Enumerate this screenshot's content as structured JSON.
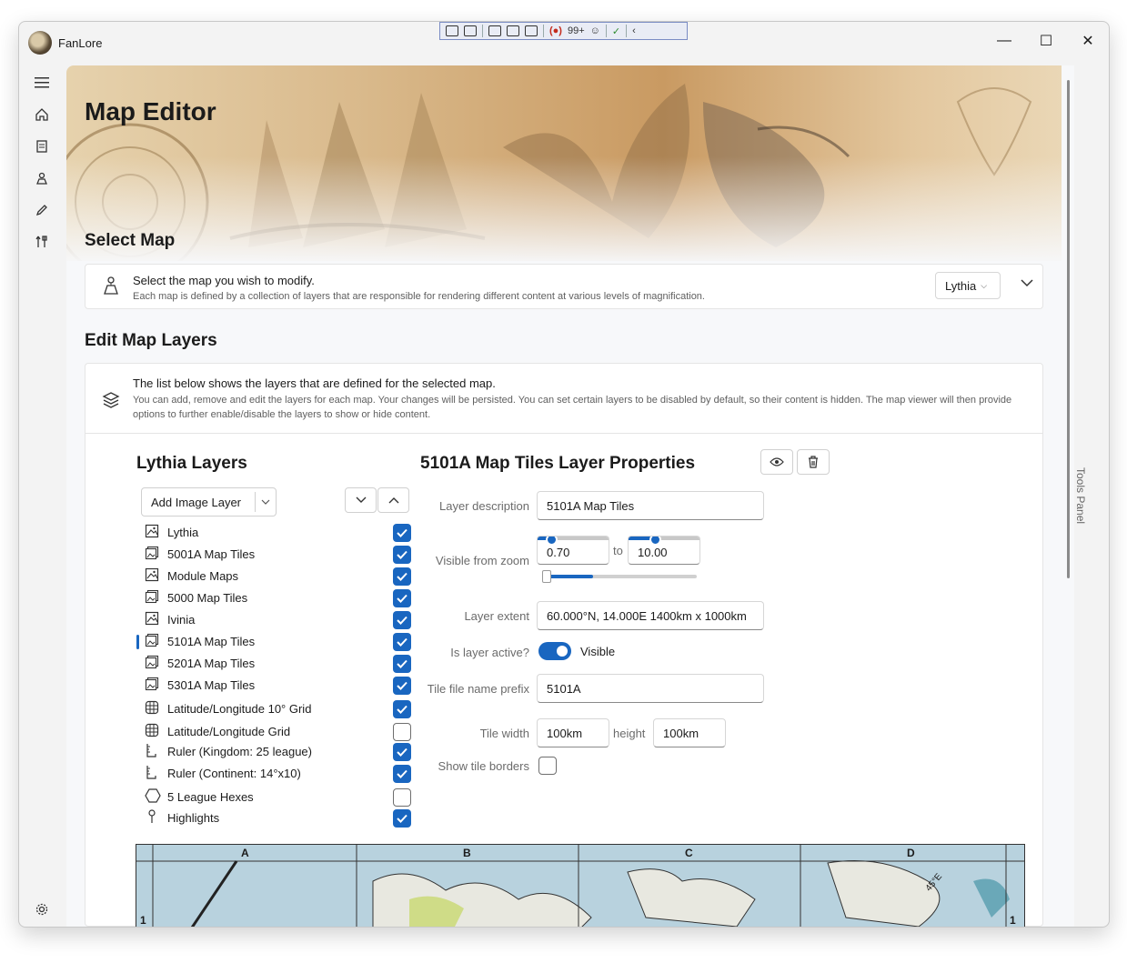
{
  "app": {
    "title": "FanLore"
  },
  "debug_toolbar": {
    "badge": "99+"
  },
  "window_controls": {
    "minimize": "—",
    "maximize": "☐",
    "close": "✕"
  },
  "nav": {
    "items": [
      "menu",
      "home",
      "notes",
      "map",
      "edit",
      "tools"
    ],
    "settings": "settings"
  },
  "page": {
    "title": "Map Editor"
  },
  "select_map": {
    "section_title": "Select Map",
    "heading": "Select the map you wish to modify.",
    "description": "Each map is defined by a collection of layers that are responsible for rendering different content at various levels of magnification.",
    "selected": "Lythia"
  },
  "edit_layers": {
    "section_title": "Edit Map Layers",
    "heading": "The list below shows the layers that are defined for the selected map.",
    "description": "You can add, remove and edit the layers for each map. Your changes will be persisted. You can set certain layers to be disabled by default, so their content is hidden. The map viewer will then provide options to further enable/disable the layers to show or hide content."
  },
  "layers_panel": {
    "title": "Lythia Layers",
    "add_button": "Add Image Layer",
    "items": [
      {
        "name": "Lythia",
        "icon": "image-icon",
        "checked": true
      },
      {
        "name": "5001A Map Tiles",
        "icon": "image-stack-icon",
        "checked": true
      },
      {
        "name": "Module Maps",
        "icon": "image-icon",
        "checked": true
      },
      {
        "name": "5000 Map Tiles",
        "icon": "image-stack-icon",
        "checked": true
      },
      {
        "name": "Ivinia",
        "icon": "image-icon",
        "checked": true
      },
      {
        "name": "5101A Map Tiles",
        "icon": "image-stack-icon",
        "checked": true,
        "selected": true
      },
      {
        "name": "5201A Map Tiles",
        "icon": "image-stack-icon",
        "checked": true
      },
      {
        "name": "5301A Map Tiles",
        "icon": "image-stack-icon",
        "checked": true
      },
      {
        "name": "Latitude/Longitude 10° Grid",
        "icon": "globe-grid-icon",
        "checked": true
      },
      {
        "name": "Latitude/Longitude Grid",
        "icon": "globe-grid-icon",
        "checked": false
      },
      {
        "name": "Ruler (Kingdom: 25 league)",
        "icon": "ruler-icon",
        "checked": true
      },
      {
        "name": "Ruler (Continent: 14°x10)",
        "icon": "ruler-icon",
        "checked": true
      },
      {
        "name": "5 League Hexes",
        "icon": "hexagon-icon",
        "checked": false
      },
      {
        "name": "Highlights",
        "icon": "pin-icon",
        "checked": true
      }
    ]
  },
  "properties": {
    "title": "5101A Map Tiles Layer Properties",
    "description_label": "Layer description",
    "description_value": "5101A Map Tiles",
    "zoom_label": "Visible from zoom",
    "zoom_from": "0.70",
    "zoom_to_word": "to",
    "zoom_to": "10.00",
    "extent_label": "Layer extent",
    "extent_value": "60.000°N, 14.000E 1400km x 1000km",
    "active_label": "Is layer active?",
    "active_state": "Visible",
    "prefix_label": "Tile file name prefix",
    "prefix_value": "5101A",
    "tile_width_label": "Tile width",
    "tile_width": "100km",
    "tile_height_label": "height",
    "tile_height": "100km",
    "borders_label": "Show tile borders"
  },
  "map_preview": {
    "columns": [
      "A",
      "B",
      "C",
      "D"
    ],
    "row": "1",
    "row_right": "1",
    "annotation": "45°E"
  },
  "tools_panel": {
    "label": "Tools Panel"
  }
}
